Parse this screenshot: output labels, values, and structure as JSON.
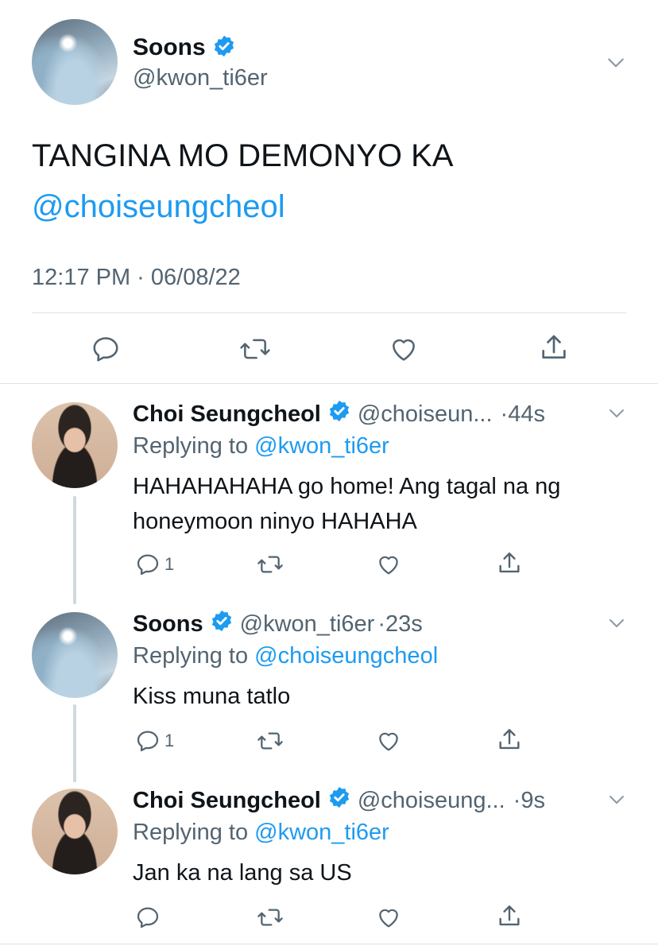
{
  "main_tweet": {
    "author_name": "Soons",
    "author_handle": "@kwon_ti6er",
    "text": "TANGINA MO DEMONYO KA",
    "mention": "@choiseungcheol",
    "timestamp": "12:17 PM · 06/08/22"
  },
  "replies": [
    {
      "author_name": "Choi Seungcheol",
      "author_handle": "@choiseun...",
      "time": "·44s",
      "replying_prefix": "Replying to",
      "replying_to": "@kwon_ti6er",
      "text_line1": "HAHAHAHAHA go home! Ang tagal na ng",
      "text_line2": "honeymoon ninyo HAHAHA",
      "reply_count": "1"
    },
    {
      "author_name": "Soons",
      "author_handle": "@kwon_ti6er",
      "time": "·23s",
      "replying_prefix": "Replying to",
      "replying_to": "@choiseungcheol",
      "text_line1": "Kiss muna tatlo",
      "reply_count": "1"
    },
    {
      "author_name": "Choi Seungcheol",
      "author_handle": "@choiseung...",
      "time": "·9s",
      "replying_prefix": "Replying to",
      "replying_to": "@kwon_ti6er",
      "text_line1": "Jan ka na lang sa US",
      "reply_count": ""
    }
  ],
  "colors": {
    "link": "#1d9bf0",
    "verified": "#1d9bf0",
    "muted": "#536471"
  },
  "icons": [
    "chevron-down-icon",
    "verified-badge-icon",
    "reply-icon",
    "retweet-icon",
    "like-icon",
    "share-icon"
  ]
}
